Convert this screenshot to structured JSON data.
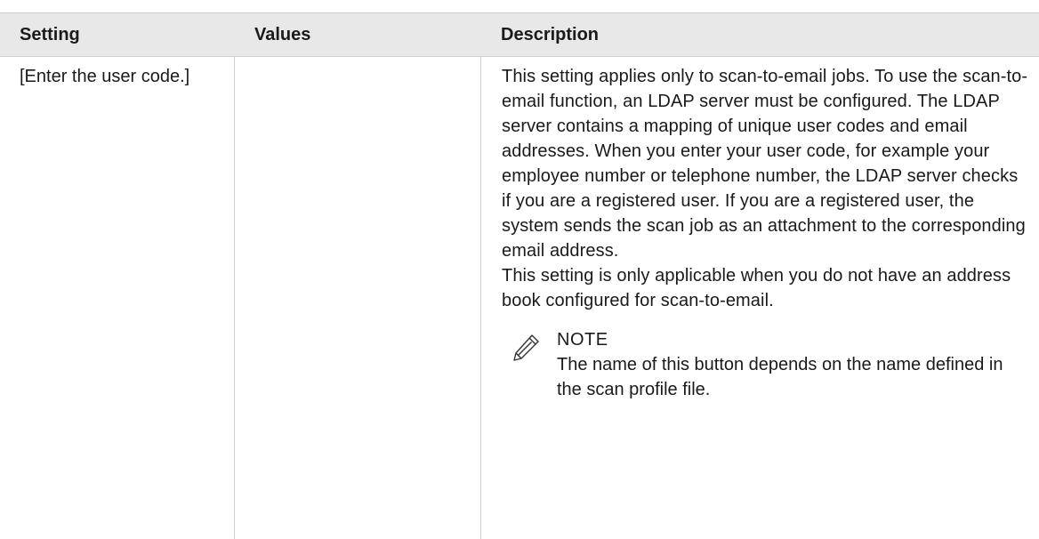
{
  "table": {
    "headers": {
      "setting": "Setting",
      "values": "Values",
      "description": "Description"
    },
    "row": {
      "setting": "[Enter the user code.]",
      "values": "",
      "description_para1": "This setting applies only to scan-to-email jobs. To use the scan-to-email function, an LDAP server must be configured. The LDAP server contains a mapping of unique user codes and email address­es. When you enter your user code, for example your employee number or telephone number, the LDAP server checks if you are a registered user. If you are a registered user, the system sends the scan job as an attachment to the corresponding email address.",
      "description_para2": "This setting is only applicable when you do not have an address book configured for scan-to-email.",
      "note": {
        "icon": "pencil-icon",
        "title": "NOTE",
        "text": "The name of this button depends on the name defined in the scan profile file."
      }
    }
  }
}
